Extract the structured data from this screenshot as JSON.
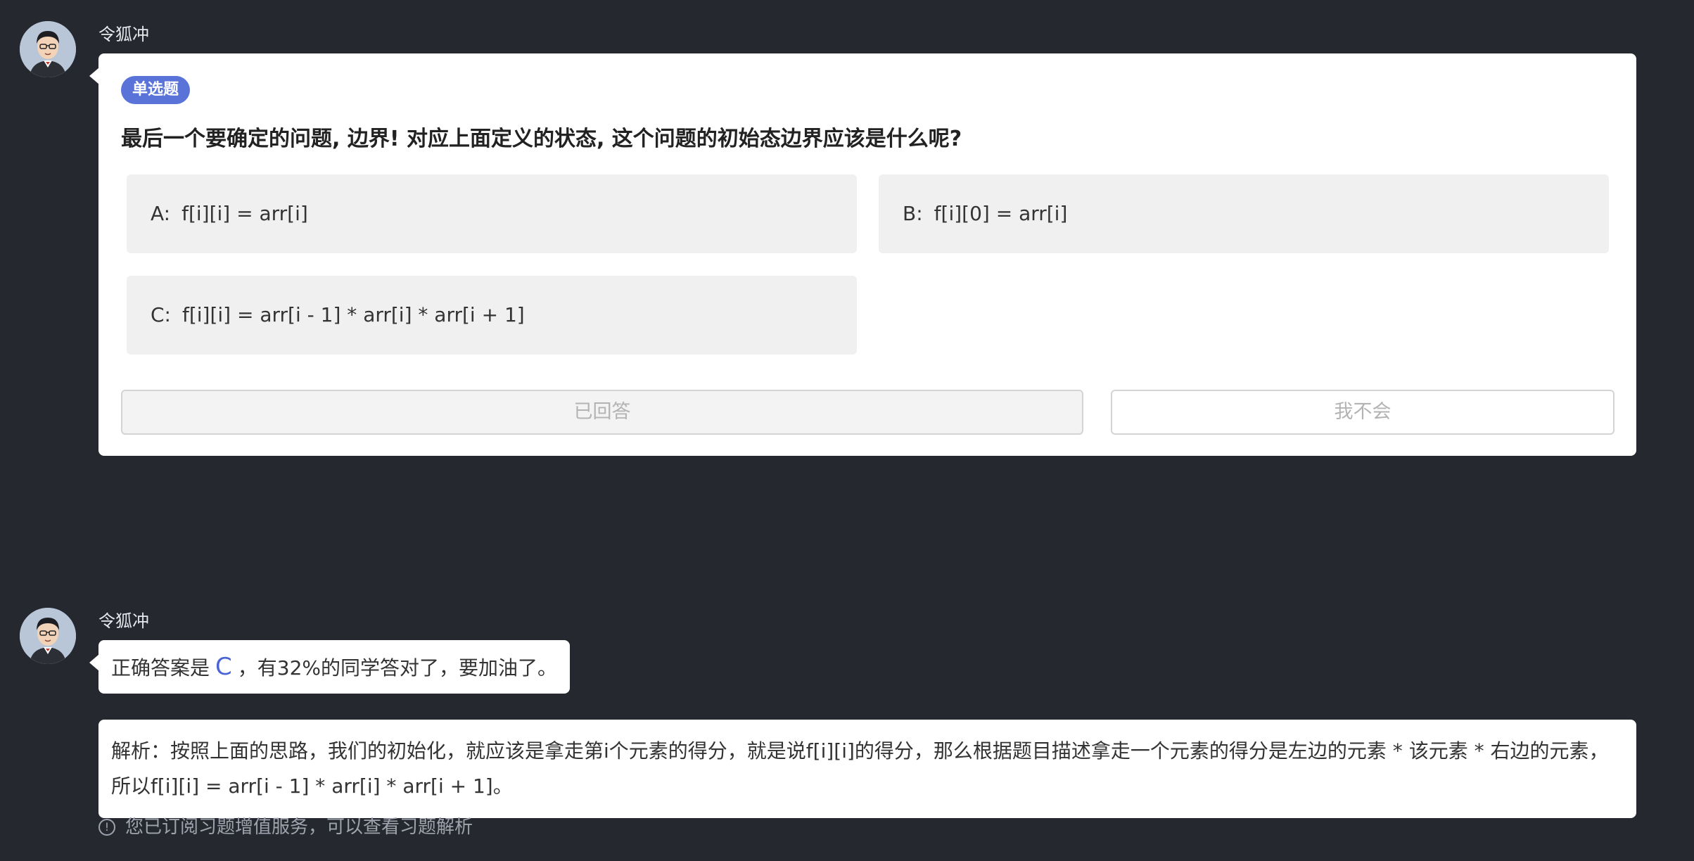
{
  "messages": [
    {
      "sender": "令狐冲",
      "quiz": {
        "type_badge": "单选题",
        "question": "最后一个要确定的问题, 边界! 对应上面定义的状态, 这个问题的初始态边界应该是什么呢?",
        "options": [
          {
            "letter": "A:",
            "text": "f[i][i] = arr[i]"
          },
          {
            "letter": "B:",
            "text": "f[i][0] = arr[i]"
          },
          {
            "letter": "C:",
            "text": "f[i][i] = arr[i - 1] * arr[i] * arr[i + 1]"
          }
        ],
        "answered_label": "已回答",
        "dont_know_label": "我不会"
      }
    },
    {
      "sender": "令狐冲",
      "answer": {
        "prefix": "正确答案是",
        "letter": "C",
        "suffix": "，有32%的同学答对了，要加油了。"
      },
      "analysis": "解析：按照上面的思路，我们的初始化，就应该是拿走第i个元素的得分，就是说f[i][i]的得分，那么根据题目描述拿走一个元素的得分是左边的元素 * 该元素 * 右边的元素，所以f[i][i] = arr[i - 1] * arr[i] * arr[i + 1]。",
      "notice": {
        "icon": "info-icon",
        "text": "您已订阅习题增值服务，可以查看习题解析"
      }
    }
  ],
  "colors": {
    "background": "#25282f",
    "accent": "#5a73d9",
    "answer_letter": "#4a63d6"
  }
}
